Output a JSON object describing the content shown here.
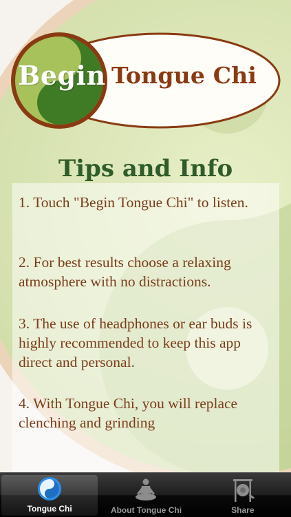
{
  "header": {
    "begin_button_label": "Begin",
    "app_title": "Tongue Chi"
  },
  "tips": {
    "heading": "Tips and Info",
    "items": [
      "1. Touch \"Begin Tongue Chi\" to listen.",
      "2. For best results choose a relaxing atmosphere with no distractions.",
      "3.   The use of headphones or ear buds is highly recommended to keep this app direct and personal.",
      "4.  With Tongue Chi, you will replace clenching and grinding"
    ]
  },
  "tabbar": {
    "tabs": [
      {
        "label": "Tongue Chi",
        "icon": "yin-yang-icon",
        "active": true
      },
      {
        "label": "About Tongue Chi",
        "icon": "meditating-person-icon",
        "active": false
      },
      {
        "label": "Share",
        "icon": "gong-icon",
        "active": false
      }
    ]
  },
  "colors": {
    "title_brown": "#8a3a12",
    "tips_green": "#2f5c2a",
    "text_brown": "#7a3d1a",
    "accent_blue": "#2b8fe8"
  }
}
